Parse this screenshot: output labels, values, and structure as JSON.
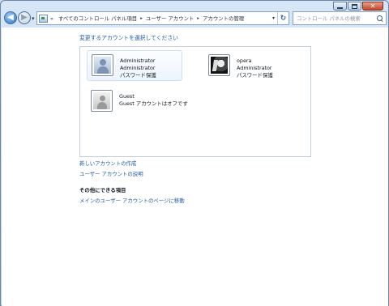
{
  "window": {
    "caption_buttons": {
      "minimize_icon": "minimize-icon",
      "maximize_icon": "maximize-icon",
      "close_glyph": "✕"
    }
  },
  "nav": {
    "back_glyph": "◀",
    "forward_glyph": "▶",
    "recent_glyph": "▾"
  },
  "address": {
    "overflow": "«",
    "crumbs": [
      "すべてのコントロール パネル項目",
      "ユーザー アカウント",
      "アカウントの管理"
    ],
    "separator": "▸",
    "dropdown_glyph": "▾",
    "refresh_glyph": "↻"
  },
  "search": {
    "placeholder": "コントロール パネルの検索"
  },
  "main": {
    "heading": "変更するアカウントを選択してください",
    "accounts": [
      {
        "name": "Administrator",
        "type": "Administrator",
        "status": "パスワード保護",
        "selected": true
      },
      {
        "name": "opera",
        "type": "Administrator",
        "status": "パスワード保護",
        "selected": false
      },
      {
        "name": "Guest",
        "type": "Guest アカウントはオフです",
        "status": "",
        "selected": false
      }
    ],
    "links": {
      "create_account": "新しいアカウントの作成",
      "about_accounts": "ユーザー アカウントの説明"
    },
    "other_tasks": {
      "title": "その他にできる項目",
      "main_page_link": "メインのユーザー アカウントのページに移動"
    }
  },
  "colors": {
    "link": "#1e5aa0",
    "window_frame": "#c6d9ee",
    "close_button": "#c4452c"
  }
}
